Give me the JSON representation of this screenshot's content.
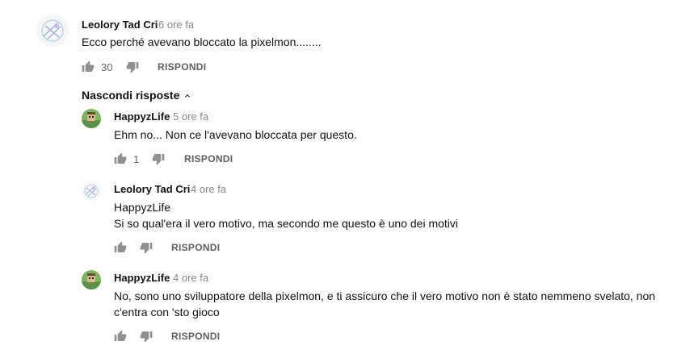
{
  "comment": {
    "author": "Leolory Tad Cri",
    "time": "6 ore fa",
    "text": "Ecco perché avevano bloccato la pixelmon........",
    "likes": "30",
    "reply_label": "RISPONDI"
  },
  "toggle_label": "Nascondi risposte",
  "replies": [
    {
      "author": "HappyzLife",
      "time": "5 ore fa",
      "text": "Ehm no... Non ce l'avevano bloccata per questo.",
      "likes": "1",
      "reply_label": "RISPONDI"
    },
    {
      "author": "Leolory Tad Cri",
      "time": "4 ore fa",
      "line1": "HappyzLife",
      "line2": "Si so qual'era il vero motivo, ma secondo me questo è uno dei motivi",
      "reply_label": "RISPONDI"
    },
    {
      "author": "HappyzLife",
      "time": "4 ore fa",
      "line1": "No, sono uno sviluppatore della pixelmon, e ti assicuro che il vero motivo non è stato nemmeno svelato, non",
      "line2": "c'entra con 'sto gioco",
      "reply_label": "RISPONDI"
    }
  ],
  "icons": {
    "like": "thumb-up-icon",
    "dislike": "thumb-down-icon",
    "toggle": "chevron-up-icon"
  },
  "colors": {
    "icon": "#909090",
    "meta": "#888888",
    "reply_button": "#606060"
  }
}
